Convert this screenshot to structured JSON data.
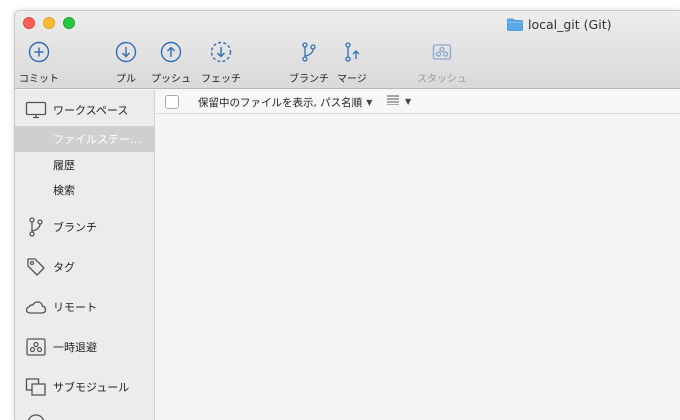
{
  "window": {
    "title": "local_git (Git)",
    "folder_icon": "folder-icon",
    "colors": {
      "accent": "#2f6fb7",
      "folder": "#5aa9e6"
    }
  },
  "toolbar": {
    "commit": {
      "label": "コミット",
      "icon": "plus-circle-icon"
    },
    "pull": {
      "label": "プル",
      "icon": "arrow-down-circle-icon"
    },
    "push": {
      "label": "プッシュ",
      "icon": "arrow-up-circle-icon"
    },
    "fetch": {
      "label": "フェッチ",
      "icon": "dashed-arrow-down-circle-icon"
    },
    "branch": {
      "label": "ブランチ",
      "icon": "branch-icon"
    },
    "merge": {
      "label": "マージ",
      "icon": "merge-icon"
    },
    "stash": {
      "label": "スタッシュ",
      "icon": "stash-icon",
      "disabled": true
    }
  },
  "sidebar": {
    "workspace": {
      "label": "ワークスペース",
      "icon": "monitor-icon"
    },
    "workspace_items": [
      {
        "label": "ファイルステー…",
        "active": true
      },
      {
        "label": "履歴",
        "active": false
      },
      {
        "label": "検索",
        "active": false
      }
    ],
    "branches": {
      "label": "ブランチ",
      "icon": "branch-icon"
    },
    "tags": {
      "label": "タグ",
      "icon": "tag-icon"
    },
    "remotes": {
      "label": "リモート",
      "icon": "cloud-icon"
    },
    "stashes": {
      "label": "一時退避",
      "icon": "stash-icon"
    },
    "submodules": {
      "label": "サブモジュール",
      "icon": "submodule-icon"
    }
  },
  "main": {
    "sort_select": {
      "value": "保留中のファイルを表示, パス名順"
    },
    "view_select": {
      "icon": "list-lines-icon"
    }
  }
}
